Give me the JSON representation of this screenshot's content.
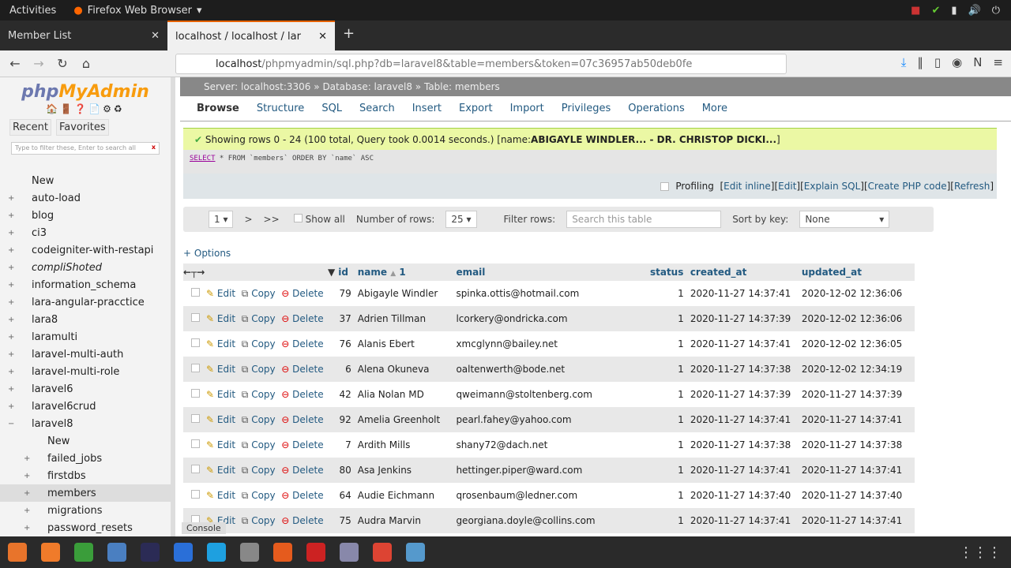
{
  "os": {
    "activities": "Activities",
    "app": "Firefox Web Browser"
  },
  "browser": {
    "tabs": [
      {
        "label": "Member List"
      },
      {
        "label": "localhost / localhost / lar"
      }
    ],
    "url_host": "localhost",
    "url_path": "/phpmyadmin/sql.php?db=laravel8&table=members&token=07c36957ab50deb0fe"
  },
  "sidebar": {
    "logo_php": "php",
    "logo_myadmin": "MyAdmin",
    "recent": "Recent",
    "favorites": "Favorites",
    "filter_placeholder": "Type to filter these, Enter to search all",
    "items": [
      {
        "label": "New",
        "level": 0
      },
      {
        "label": "auto-load",
        "level": 0
      },
      {
        "label": "blog",
        "level": 0
      },
      {
        "label": "ci3",
        "level": 0
      },
      {
        "label": "codeigniter-with-restapi",
        "level": 0
      },
      {
        "label": "compliShoted",
        "level": 0
      },
      {
        "label": "information_schema",
        "level": 0
      },
      {
        "label": "lara-angular-pracctice",
        "level": 0
      },
      {
        "label": "lara8",
        "level": 0
      },
      {
        "label": "laramulti",
        "level": 0
      },
      {
        "label": "laravel-multi-auth",
        "level": 0
      },
      {
        "label": "laravel-multi-role",
        "level": 0
      },
      {
        "label": "laravel6",
        "level": 0
      },
      {
        "label": "laravel6crud",
        "level": 0
      },
      {
        "label": "laravel8",
        "level": 0
      },
      {
        "label": "New",
        "level": 1
      },
      {
        "label": "failed_jobs",
        "level": 1
      },
      {
        "label": "firstdbs",
        "level": 1
      },
      {
        "label": "members",
        "level": 1,
        "selected": true
      },
      {
        "label": "migrations",
        "level": 1
      },
      {
        "label": "password_resets",
        "level": 1
      }
    ]
  },
  "breadcrumb": {
    "server": "Server: localhost:3306",
    "database": "Database: laravel8",
    "table": "Table: members"
  },
  "menu": [
    "Browse",
    "Structure",
    "SQL",
    "Search",
    "Insert",
    "Export",
    "Import",
    "Privileges",
    "Operations",
    "More"
  ],
  "message": {
    "text": "Showing rows 0 - 24 (100 total, Query took 0.0014 seconds.) [name: ",
    "bold": "ABIGAYLE WINDLER... - DR. CHRISTOP DICKI...",
    "end": "]"
  },
  "sql": {
    "select": "SELECT",
    "rest": " * FROM `members` ORDER BY `name` ASC"
  },
  "profiling": {
    "label": "Profiling",
    "links": [
      "Edit inline",
      "Edit",
      "Explain SQL",
      "Create PHP code",
      "Refresh"
    ]
  },
  "nav": {
    "page": "1",
    "next": ">",
    "last": ">>",
    "show_all": "Show all",
    "rows_label": "Number of rows:",
    "rows": "25",
    "filter_label": "Filter rows:",
    "filter_placeholder": "Search this table",
    "sort_label": "Sort by key:",
    "sort": "None"
  },
  "options": "+ Options",
  "columns": [
    "id",
    "name",
    "email",
    "status",
    "created_at",
    "updated_at"
  ],
  "sort_indicator": "1",
  "actions": {
    "edit": "Edit",
    "copy": "Copy",
    "delete": "Delete"
  },
  "rows": [
    [
      "79",
      "Abigayle Windler",
      "spinka.ottis@hotmail.com",
      "1",
      "2020-11-27 14:37:41",
      "2020-12-02 12:36:06"
    ],
    [
      "37",
      "Adrien Tillman",
      "lcorkery@ondricka.com",
      "1",
      "2020-11-27 14:37:39",
      "2020-12-02 12:36:06"
    ],
    [
      "76",
      "Alanis Ebert",
      "xmcglynn@bailey.net",
      "1",
      "2020-11-27 14:37:41",
      "2020-12-02 12:36:05"
    ],
    [
      "6",
      "Alena Okuneva",
      "oaltenwerth@bode.net",
      "1",
      "2020-11-27 14:37:38",
      "2020-12-02 12:34:19"
    ],
    [
      "42",
      "Alia Nolan MD",
      "qweimann@stoltenberg.com",
      "1",
      "2020-11-27 14:37:39",
      "2020-11-27 14:37:39"
    ],
    [
      "92",
      "Amelia Greenholt",
      "pearl.fahey@yahoo.com",
      "1",
      "2020-11-27 14:37:41",
      "2020-11-27 14:37:41"
    ],
    [
      "7",
      "Ardith Mills",
      "shany72@dach.net",
      "1",
      "2020-11-27 14:37:38",
      "2020-11-27 14:37:38"
    ],
    [
      "80",
      "Asa Jenkins",
      "hettinger.piper@ward.com",
      "1",
      "2020-11-27 14:37:41",
      "2020-11-27 14:37:41"
    ],
    [
      "64",
      "Audie Eichmann",
      "qrosenbaum@ledner.com",
      "1",
      "2020-11-27 14:37:40",
      "2020-11-27 14:37:40"
    ],
    [
      "75",
      "Audra Marvin",
      "georgiana.doyle@collins.com",
      "1",
      "2020-11-27 14:37:41",
      "2020-11-27 14:37:41"
    ]
  ],
  "console": "Console"
}
